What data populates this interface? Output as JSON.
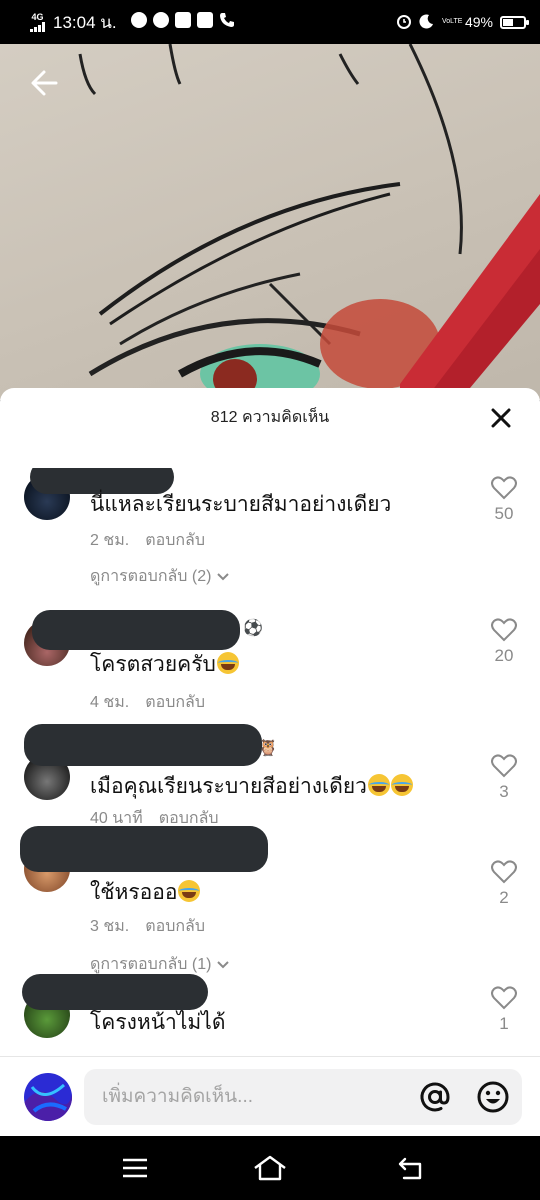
{
  "statusbar": {
    "network": "4G",
    "time": "13:04 น.",
    "volte": "VoLTE",
    "battery": "49%",
    "icons_left": [
      "message-icon",
      "messenger-icon",
      "youtube-icon",
      "game-icon",
      "phone-icon"
    ],
    "icons_right": [
      "alarm-icon",
      "moon-icon",
      "volte-icon",
      "battery-icon"
    ]
  },
  "header": {
    "title": "812 ความคิดเห็น"
  },
  "comments": [
    {
      "text": "นี่แหละเรียนระบายสีมาอย่างเดียว",
      "time": "2 ชม.",
      "reply": "ตอบกลับ",
      "view_replies": "ดูการตอบกลับ (2)",
      "likes": "50"
    },
    {
      "text": "โครตสวยครับ",
      "time": "4 ชม.",
      "reply": "ตอบกลับ",
      "view_replies": "",
      "likes": "20",
      "name_emoji": "⚽"
    },
    {
      "text": "เมือคุณเรียนระบายสีอย่างเดียว",
      "time": "40 นาที",
      "reply": "ตอบกลับ",
      "view_replies": "",
      "likes": "3",
      "name_emoji": "🦉"
    },
    {
      "text": "ใช้หรอออ",
      "time": "3 ชม.",
      "reply": "ตอบกลับ",
      "view_replies": "ดูการตอบกลับ (1)",
      "likes": "2"
    },
    {
      "text": "โครงหน้าไม่ได้",
      "time": "",
      "reply": "",
      "view_replies": "",
      "likes": "1"
    }
  ],
  "input": {
    "placeholder": "เพิ่มความคิดเห็น..."
  },
  "colors": {
    "sheet_bg": "#ffffff",
    "meta_text": "#8a8a8a",
    "redaction": "#2b2f33",
    "input_bg": "#f1f1f2"
  }
}
